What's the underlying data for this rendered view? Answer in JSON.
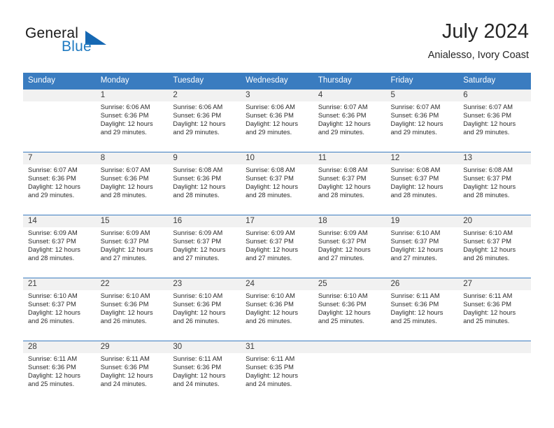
{
  "brand": {
    "word_one": "General",
    "word_two": "Blue",
    "accent_color": "#1668b3"
  },
  "header": {
    "title": "July 2024",
    "subtitle": "Anialesso, Ivory Coast"
  },
  "theme": {
    "header_blue": "#3a7cc0",
    "daynum_band": "#f1f1f1"
  },
  "weekday_headers": [
    "Sunday",
    "Monday",
    "Tuesday",
    "Wednesday",
    "Thursday",
    "Friday",
    "Saturday"
  ],
  "weeks": [
    [
      {
        "day": "",
        "lines": []
      },
      {
        "day": "1",
        "lines": [
          "Sunrise: 6:06 AM",
          "Sunset: 6:36 PM",
          "Daylight: 12 hours",
          "and 29 minutes."
        ]
      },
      {
        "day": "2",
        "lines": [
          "Sunrise: 6:06 AM",
          "Sunset: 6:36 PM",
          "Daylight: 12 hours",
          "and 29 minutes."
        ]
      },
      {
        "day": "3",
        "lines": [
          "Sunrise: 6:06 AM",
          "Sunset: 6:36 PM",
          "Daylight: 12 hours",
          "and 29 minutes."
        ]
      },
      {
        "day": "4",
        "lines": [
          "Sunrise: 6:07 AM",
          "Sunset: 6:36 PM",
          "Daylight: 12 hours",
          "and 29 minutes."
        ]
      },
      {
        "day": "5",
        "lines": [
          "Sunrise: 6:07 AM",
          "Sunset: 6:36 PM",
          "Daylight: 12 hours",
          "and 29 minutes."
        ]
      },
      {
        "day": "6",
        "lines": [
          "Sunrise: 6:07 AM",
          "Sunset: 6:36 PM",
          "Daylight: 12 hours",
          "and 29 minutes."
        ]
      }
    ],
    [
      {
        "day": "7",
        "lines": [
          "Sunrise: 6:07 AM",
          "Sunset: 6:36 PM",
          "Daylight: 12 hours",
          "and 29 minutes."
        ]
      },
      {
        "day": "8",
        "lines": [
          "Sunrise: 6:07 AM",
          "Sunset: 6:36 PM",
          "Daylight: 12 hours",
          "and 28 minutes."
        ]
      },
      {
        "day": "9",
        "lines": [
          "Sunrise: 6:08 AM",
          "Sunset: 6:36 PM",
          "Daylight: 12 hours",
          "and 28 minutes."
        ]
      },
      {
        "day": "10",
        "lines": [
          "Sunrise: 6:08 AM",
          "Sunset: 6:37 PM",
          "Daylight: 12 hours",
          "and 28 minutes."
        ]
      },
      {
        "day": "11",
        "lines": [
          "Sunrise: 6:08 AM",
          "Sunset: 6:37 PM",
          "Daylight: 12 hours",
          "and 28 minutes."
        ]
      },
      {
        "day": "12",
        "lines": [
          "Sunrise: 6:08 AM",
          "Sunset: 6:37 PM",
          "Daylight: 12 hours",
          "and 28 minutes."
        ]
      },
      {
        "day": "13",
        "lines": [
          "Sunrise: 6:08 AM",
          "Sunset: 6:37 PM",
          "Daylight: 12 hours",
          "and 28 minutes."
        ]
      }
    ],
    [
      {
        "day": "14",
        "lines": [
          "Sunrise: 6:09 AM",
          "Sunset: 6:37 PM",
          "Daylight: 12 hours",
          "and 28 minutes."
        ]
      },
      {
        "day": "15",
        "lines": [
          "Sunrise: 6:09 AM",
          "Sunset: 6:37 PM",
          "Daylight: 12 hours",
          "and 27 minutes."
        ]
      },
      {
        "day": "16",
        "lines": [
          "Sunrise: 6:09 AM",
          "Sunset: 6:37 PM",
          "Daylight: 12 hours",
          "and 27 minutes."
        ]
      },
      {
        "day": "17",
        "lines": [
          "Sunrise: 6:09 AM",
          "Sunset: 6:37 PM",
          "Daylight: 12 hours",
          "and 27 minutes."
        ]
      },
      {
        "day": "18",
        "lines": [
          "Sunrise: 6:09 AM",
          "Sunset: 6:37 PM",
          "Daylight: 12 hours",
          "and 27 minutes."
        ]
      },
      {
        "day": "19",
        "lines": [
          "Sunrise: 6:10 AM",
          "Sunset: 6:37 PM",
          "Daylight: 12 hours",
          "and 27 minutes."
        ]
      },
      {
        "day": "20",
        "lines": [
          "Sunrise: 6:10 AM",
          "Sunset: 6:37 PM",
          "Daylight: 12 hours",
          "and 26 minutes."
        ]
      }
    ],
    [
      {
        "day": "21",
        "lines": [
          "Sunrise: 6:10 AM",
          "Sunset: 6:37 PM",
          "Daylight: 12 hours",
          "and 26 minutes."
        ]
      },
      {
        "day": "22",
        "lines": [
          "Sunrise: 6:10 AM",
          "Sunset: 6:36 PM",
          "Daylight: 12 hours",
          "and 26 minutes."
        ]
      },
      {
        "day": "23",
        "lines": [
          "Sunrise: 6:10 AM",
          "Sunset: 6:36 PM",
          "Daylight: 12 hours",
          "and 26 minutes."
        ]
      },
      {
        "day": "24",
        "lines": [
          "Sunrise: 6:10 AM",
          "Sunset: 6:36 PM",
          "Daylight: 12 hours",
          "and 26 minutes."
        ]
      },
      {
        "day": "25",
        "lines": [
          "Sunrise: 6:10 AM",
          "Sunset: 6:36 PM",
          "Daylight: 12 hours",
          "and 25 minutes."
        ]
      },
      {
        "day": "26",
        "lines": [
          "Sunrise: 6:11 AM",
          "Sunset: 6:36 PM",
          "Daylight: 12 hours",
          "and 25 minutes."
        ]
      },
      {
        "day": "27",
        "lines": [
          "Sunrise: 6:11 AM",
          "Sunset: 6:36 PM",
          "Daylight: 12 hours",
          "and 25 minutes."
        ]
      }
    ],
    [
      {
        "day": "28",
        "lines": [
          "Sunrise: 6:11 AM",
          "Sunset: 6:36 PM",
          "Daylight: 12 hours",
          "and 25 minutes."
        ]
      },
      {
        "day": "29",
        "lines": [
          "Sunrise: 6:11 AM",
          "Sunset: 6:36 PM",
          "Daylight: 12 hours",
          "and 24 minutes."
        ]
      },
      {
        "day": "30",
        "lines": [
          "Sunrise: 6:11 AM",
          "Sunset: 6:36 PM",
          "Daylight: 12 hours",
          "and 24 minutes."
        ]
      },
      {
        "day": "31",
        "lines": [
          "Sunrise: 6:11 AM",
          "Sunset: 6:35 PM",
          "Daylight: 12 hours",
          "and 24 minutes."
        ]
      },
      {
        "day": "",
        "lines": []
      },
      {
        "day": "",
        "lines": []
      },
      {
        "day": "",
        "lines": []
      }
    ]
  ]
}
